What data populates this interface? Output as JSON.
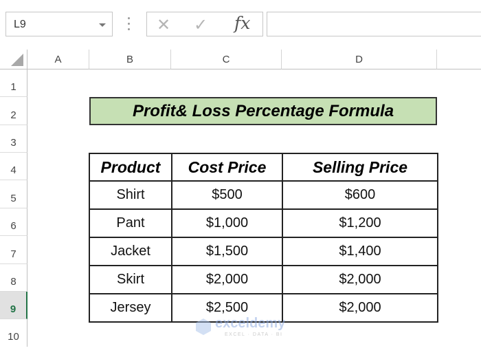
{
  "toolbar": {
    "name_box": "L9",
    "formula_icons": {
      "cancel": "✕",
      "enter": "✓",
      "fx": "fx"
    },
    "formula_value": ""
  },
  "columns": [
    "A",
    "B",
    "C",
    "D"
  ],
  "rows": [
    "1",
    "2",
    "3",
    "4",
    "5",
    "6",
    "7",
    "8",
    "9",
    "10"
  ],
  "selected_row": "9",
  "title": "Profit& Loss Percentage Formula",
  "table": {
    "headers": [
      "Product",
      "Cost Price",
      "Selling Price"
    ],
    "rows": [
      [
        "Shirt",
        "$500",
        "$600"
      ],
      [
        "Pant",
        "$1,000",
        "$1,200"
      ],
      [
        "Jacket",
        "$1,500",
        "$1,400"
      ],
      [
        "Skirt",
        "$2,000",
        "$2,000"
      ],
      [
        "Jersey",
        "$2,500",
        "$2,000"
      ]
    ]
  },
  "watermark": {
    "name": "exceldemy",
    "tagline": "EXCEL · DATA · BI"
  },
  "colors": {
    "title_fill": "#c6e0b4",
    "selection_accent": "#217346"
  }
}
